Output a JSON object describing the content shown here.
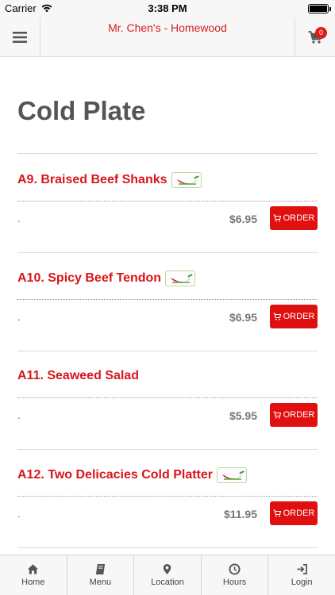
{
  "status_bar": {
    "carrier": "Carrier",
    "time": "3:38 PM"
  },
  "header": {
    "title": "Mr. Chen's - Homewood",
    "cart_count": "0"
  },
  "page": {
    "title": "Cold Plate"
  },
  "items": [
    {
      "name": "A9. Braised Beef Shanks",
      "spicy": true,
      "description": ".",
      "price": "$6.95",
      "button": "ORDER"
    },
    {
      "name": "A10. Spicy Beef Tendon",
      "spicy": true,
      "description": ".",
      "price": "$6.95",
      "button": "ORDER"
    },
    {
      "name": "A11. Seaweed Salad",
      "spicy": false,
      "description": ".",
      "price": "$5.95",
      "button": "ORDER"
    },
    {
      "name": "A12. Two Delicacies Cold Platter",
      "spicy": true,
      "description": ".",
      "price": "$11.95",
      "button": "ORDER"
    }
  ],
  "bottom_nav": [
    {
      "label": "Home",
      "icon": "home-icon"
    },
    {
      "label": "Menu",
      "icon": "book-icon"
    },
    {
      "label": "Location",
      "icon": "map-pin-icon"
    },
    {
      "label": "Hours",
      "icon": "clock-icon"
    },
    {
      "label": "Login",
      "icon": "login-icon"
    }
  ],
  "colors": {
    "accent": "#d8161b",
    "button": "#e01010"
  }
}
